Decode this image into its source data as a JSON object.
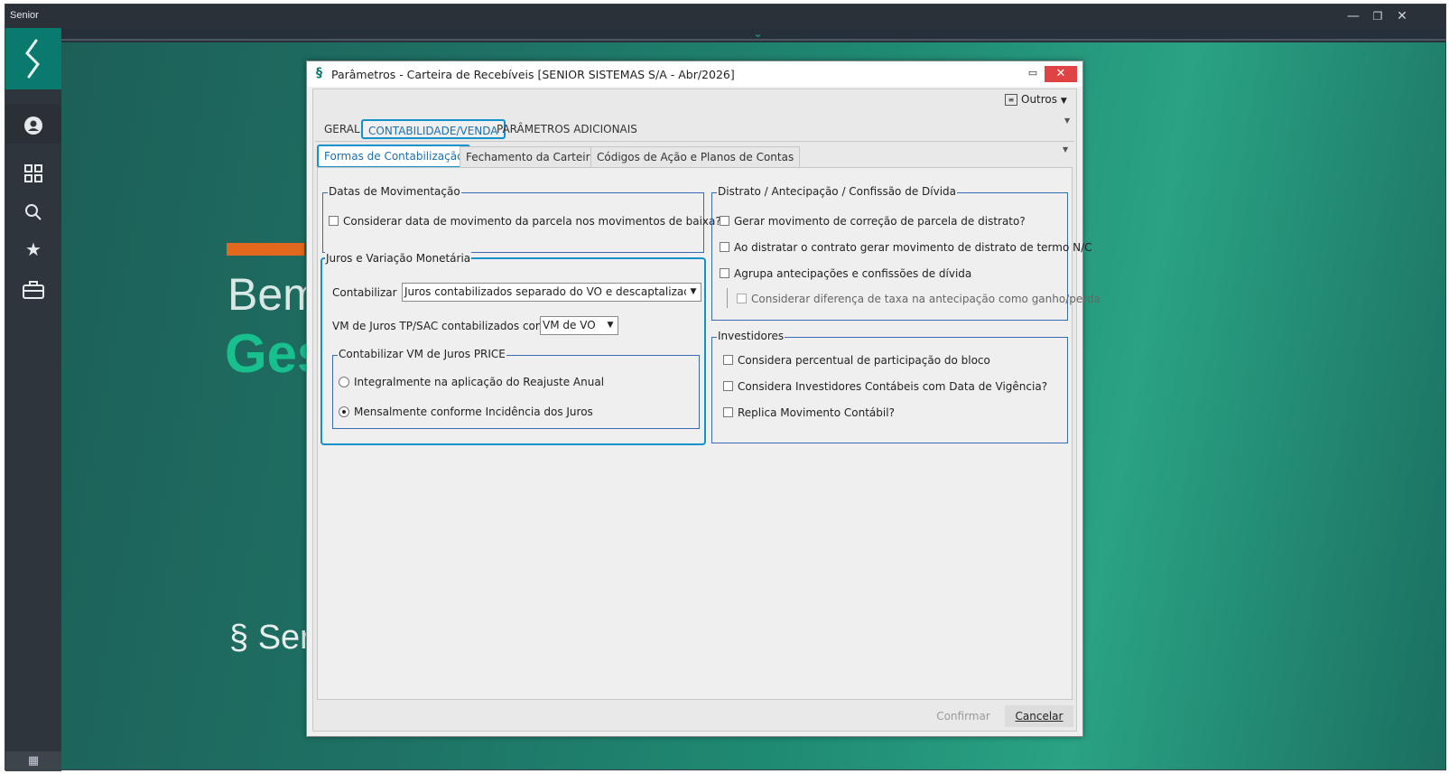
{
  "app": {
    "brand": "Senior",
    "minimize": "—",
    "restore": "❐",
    "close": "✕"
  },
  "sidebar": {
    "logo": "§",
    "user": "●",
    "grid": "▦",
    "search": "⌕",
    "star": "★",
    "briefcase": "▣",
    "calendar": "▦"
  },
  "background": {
    "greeting_partial": "Bem",
    "title_partial": "Ges",
    "logo_partial": "§ Ser"
  },
  "dialog": {
    "title": "Parâmetros - Carteira de Recebíveis [SENIOR SISTEMAS S/A - Abr/2026]",
    "outros_label": "Outros",
    "tabs": [
      "GERAL",
      "CONTABILIDADE/VENDA",
      "PARÂMETROS ADICIONAIS"
    ],
    "subtabs": [
      "Formas de Contabilização",
      "Fechamento da Carteira",
      "Códigos de Ação e Planos de Contas"
    ],
    "datas": {
      "legend": "Datas de Movimentação",
      "opt1": "Considerar data de movimento da parcela nos movimentos de baixa?"
    },
    "juros": {
      "legend": "Juros e Variação Monetária",
      "contabilizar_label": "Contabilizar",
      "contabilizar_value": "Juros contabilizados separado do VO e descaptalizados",
      "vm_label": "VM de Juros TP/SAC contabilizados como",
      "vm_value": "VM de VO",
      "price_legend": "Contabilizar VM de Juros PRICE",
      "radio1": "Integralmente na aplicação do Reajuste Anual",
      "radio2": "Mensalmente conforme Incidência dos Juros"
    },
    "distrato": {
      "legend": "Distrato / Antecipação / Confissão de Dívida",
      "opt1": "Gerar movimento de correção de parcela de distrato?",
      "opt2": "Ao distratar o contrato gerar movimento de distrato de termo N/C",
      "opt3": "Agrupa antecipações e confissões de dívida",
      "opt4": "Considerar diferença de taxa na antecipação como ganho/perda"
    },
    "investidores": {
      "legend": "Investidores",
      "opt1": "Considera percentual de participação do bloco",
      "opt2": "Considera Investidores Contábeis com Data de Vigência?",
      "opt3": "Replica Movimento Contábil?"
    },
    "confirm": "Confirmar",
    "cancel": "Cancelar"
  }
}
